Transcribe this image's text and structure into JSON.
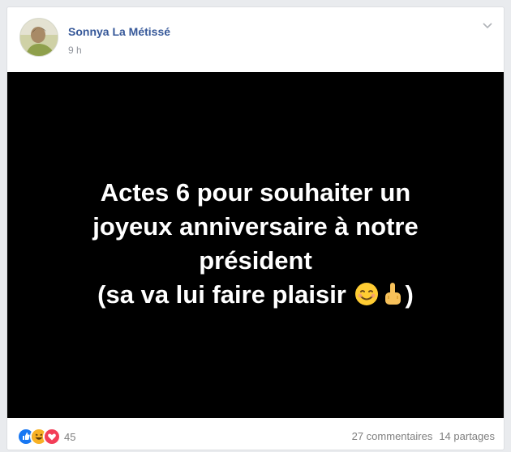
{
  "post": {
    "author": "Sonnya La Métissé",
    "time": "9 h",
    "image_text": {
      "line1": "Actes 6 pour souhaiter un",
      "line2": "joyeux anniversaire à notre",
      "line3": "président",
      "line4_prefix": "(sa va lui faire plaisir ",
      "line4_suffix": ")"
    },
    "inline_emojis": [
      "smiling-face-emoji",
      "middle-finger-emoji"
    ]
  },
  "footer": {
    "reactions": [
      "like",
      "haha",
      "love"
    ],
    "reaction_count": "45",
    "comments": "27 commentaires",
    "shares": "14 partages"
  },
  "colors": {
    "author": "#365899",
    "muted": "#90949c",
    "like": "#1877f2",
    "love": "#f33e58",
    "haha": "#f7b125"
  }
}
